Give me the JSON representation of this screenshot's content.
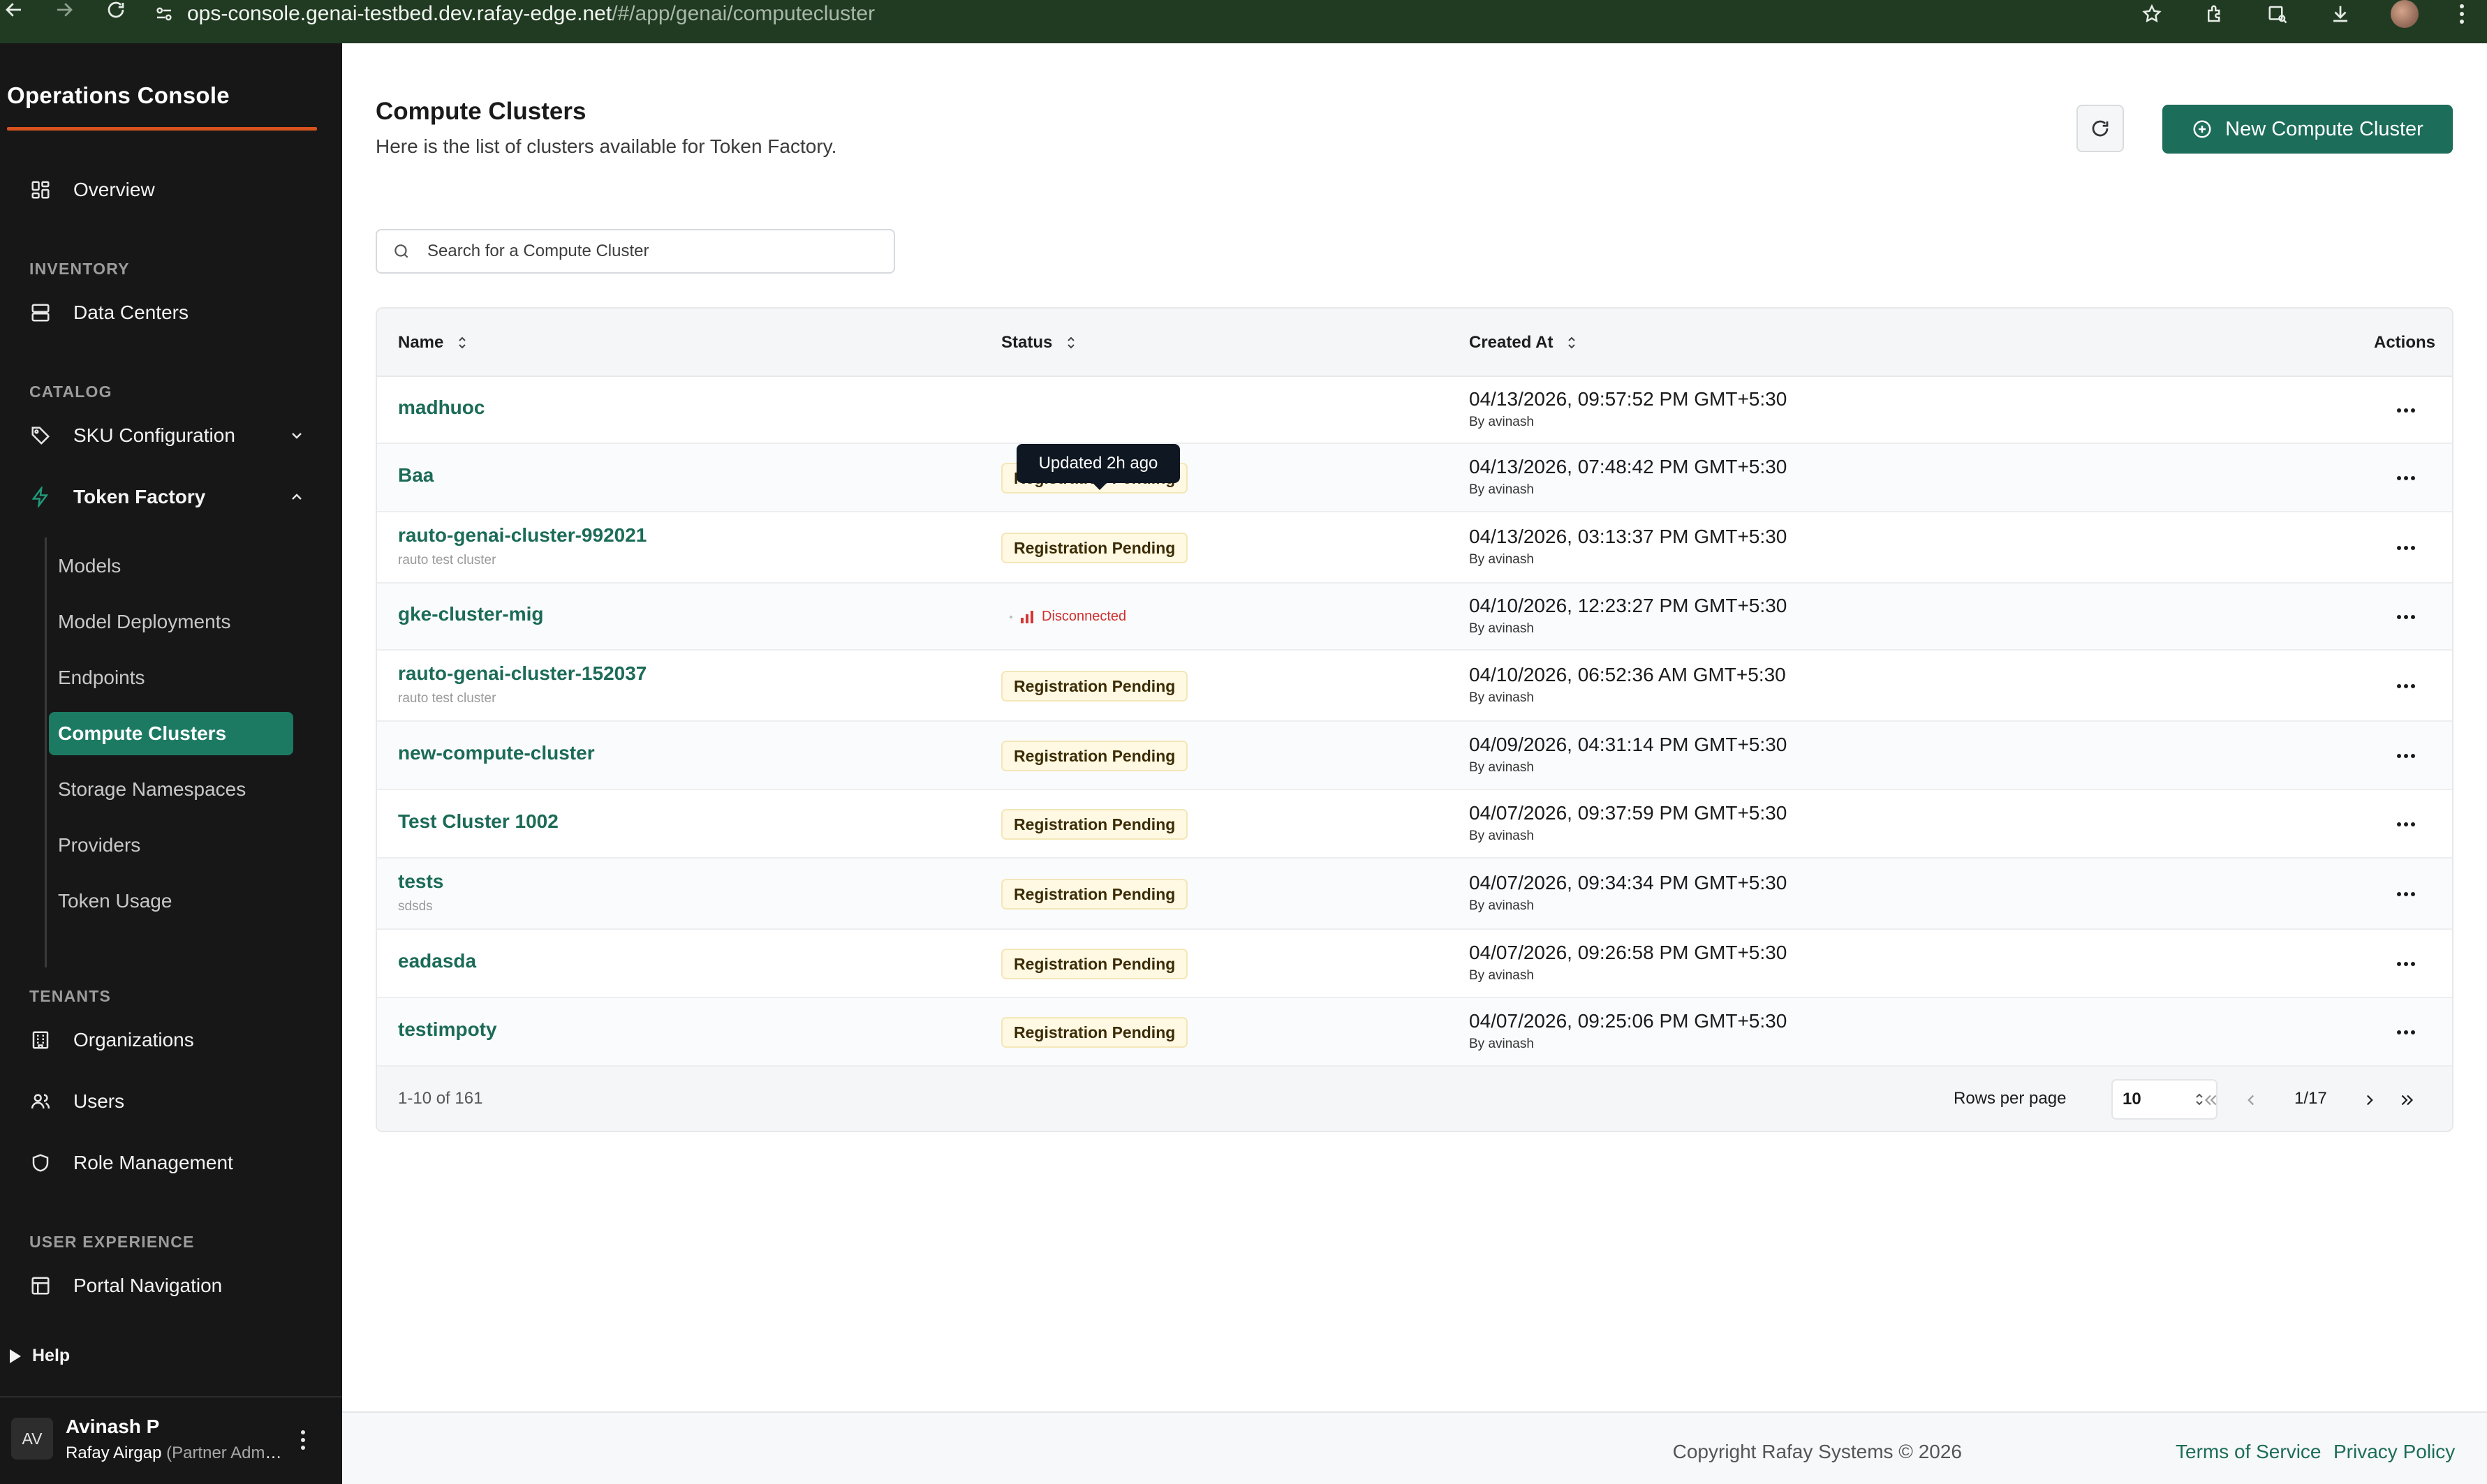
{
  "browser": {
    "url_host": "ops-console.genai-testbed.dev.rafay-edge.net",
    "url_path": "/#/app/genai/computecluster"
  },
  "sidebar": {
    "brand": "Operations Console",
    "overview": "Overview",
    "sections": {
      "inventory": "INVENTORY",
      "catalog": "CATALOG",
      "tenants": "TENANTS",
      "user_experience": "USER EXPERIENCE"
    },
    "data_centers": "Data Centers",
    "sku_configuration": "SKU Configuration",
    "token_factory": "Token Factory",
    "token_factory_items": [
      {
        "label": "Models"
      },
      {
        "label": "Model Deployments"
      },
      {
        "label": "Endpoints"
      },
      {
        "label": "Compute Clusters"
      },
      {
        "label": "Storage Namespaces"
      },
      {
        "label": "Providers"
      },
      {
        "label": "Token Usage"
      }
    ],
    "organizations": "Organizations",
    "users": "Users",
    "role_management": "Role Management",
    "portal_navigation": "Portal Navigation",
    "help": "Help",
    "user": {
      "initials": "AV",
      "name": "Avinash P",
      "org": "Rafay Airgap",
      "role": "(Partner Admin)"
    }
  },
  "page": {
    "title": "Compute Clusters",
    "subtitle": "Here is the list of clusters available for Token Factory.",
    "new_button": "New Compute Cluster",
    "search_placeholder": "Search for a Compute Cluster"
  },
  "table": {
    "columns": {
      "name": "Name",
      "status": "Status",
      "created_at": "Created At",
      "actions": "Actions"
    },
    "tooltip": "Updated 2h ago",
    "rows": [
      {
        "name": "madhuoc",
        "desc": "",
        "status": "",
        "date": "04/13/2026, 09:57:52 PM GMT+5:30",
        "by": "By avinash"
      },
      {
        "name": "Baa",
        "desc": "",
        "status": "Registration Pending",
        "date": "04/13/2026, 07:48:42 PM GMT+5:30",
        "by": "By avinash"
      },
      {
        "name": "rauto-genai-cluster-992021",
        "desc": "rauto test cluster",
        "status": "Registration Pending",
        "date": "04/13/2026, 03:13:37 PM GMT+5:30",
        "by": "By avinash"
      },
      {
        "name": "gke-cluster-mig",
        "desc": "",
        "status": "Disconnected",
        "date": "04/10/2026, 12:23:27 PM GMT+5:30",
        "by": "By avinash"
      },
      {
        "name": "rauto-genai-cluster-152037",
        "desc": "rauto test cluster",
        "status": "Registration Pending",
        "date": "04/10/2026, 06:52:36 AM GMT+5:30",
        "by": "By avinash"
      },
      {
        "name": "new-compute-cluster",
        "desc": "",
        "status": "Registration Pending",
        "date": "04/09/2026, 04:31:14 PM GMT+5:30",
        "by": "By avinash"
      },
      {
        "name": "Test Cluster 1002",
        "desc": "",
        "status": "Registration Pending",
        "date": "04/07/2026, 09:37:59 PM GMT+5:30",
        "by": "By avinash"
      },
      {
        "name": "tests",
        "desc": "sdsds",
        "status": "Registration Pending",
        "date": "04/07/2026, 09:34:34 PM GMT+5:30",
        "by": "By avinash"
      },
      {
        "name": "eadasda",
        "desc": "",
        "status": "Registration Pending",
        "date": "04/07/2026, 09:26:58 PM GMT+5:30",
        "by": "By avinash"
      },
      {
        "name": "testimpoty",
        "desc": "",
        "status": "Registration Pending",
        "date": "04/07/2026, 09:25:06 PM GMT+5:30",
        "by": "By avinash"
      }
    ],
    "range": "1-10 of 161",
    "rows_per_page_label": "Rows per page",
    "rows_per_page": "10",
    "page_indicator": "1/17"
  },
  "footer": {
    "copyright": "Copyright Rafay Systems © 2026",
    "terms": "Terms of Service",
    "privacy": "Privacy Policy"
  },
  "colors": {
    "accent": "#1c6d59",
    "sidebar_bg": "#171717",
    "brand_underline": "#d9531e",
    "pending_badge": "#fff9e3",
    "disconnected": "#cf2f2f"
  }
}
